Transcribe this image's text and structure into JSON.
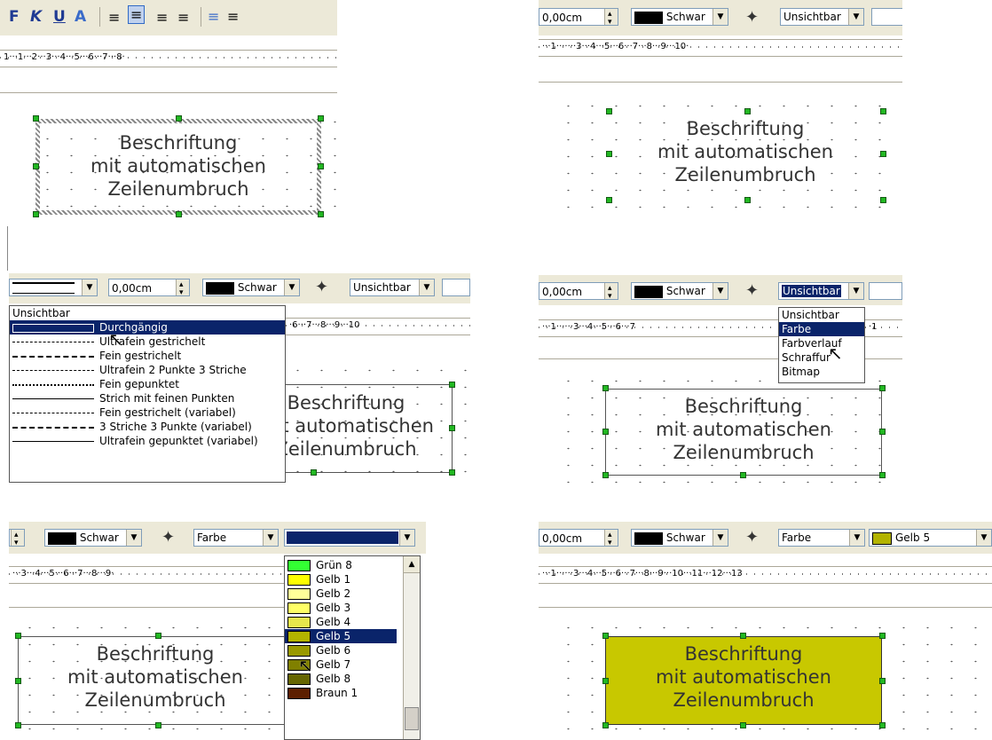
{
  "frame_text": [
    "Beschriftung",
    "mit automatischen",
    "Zeilenumbruch"
  ],
  "format_toolbar": {
    "bold": "F",
    "italic": "K",
    "underline": "U",
    "font_color": "A"
  },
  "ruler1": "1···1···2···3···4···5···6···7···8·",
  "ruler2": "···1·······3···4···5···6···7···8···9···10·",
  "ruler3": "·6···7···8···9···10",
  "ruler4": "···1······3···4···5···6···7",
  "ruler4b": "·1",
  "ruler5": "···3···4···5···6···7···8···9·",
  "ruler6": "···1······3···4···5···6···7···8···9···10···11···12···13",
  "line_width": "0,00cm",
  "line_color": "Schwar",
  "area_style_invisible": "Unsichtbar",
  "area_style_color": "Farbe",
  "fill_color_selected": "Gelb 5",
  "line_style_menu": [
    "Unsichtbar",
    "Durchgängig",
    "Ultrafein gestrichelt",
    "Fein gestrichelt",
    "Ultrafein 2 Punkte 3 Striche",
    "Fein gepunktet",
    "Strich mit feinen Punkten",
    "Fein gestrichelt (variabel)",
    "3 Striche 3 Punkte (variabel)",
    "Ultrafein gepunktet (variabel)"
  ],
  "area_style_menu": [
    "Unsichtbar",
    "Farbe",
    "Farbverlauf",
    "Schraffur",
    "Bitmap"
  ],
  "color_menu": [
    {
      "name": "Grün 8",
      "color": "#33ff33"
    },
    {
      "name": "Gelb 1",
      "color": "#ffff00"
    },
    {
      "name": "Gelb 2",
      "color": "#ffff99"
    },
    {
      "name": "Gelb 3",
      "color": "#ffff66"
    },
    {
      "name": "Gelb 4",
      "color": "#e6e64c"
    },
    {
      "name": "Gelb 5",
      "color": "#b3b300"
    },
    {
      "name": "Gelb 6",
      "color": "#999900"
    },
    {
      "name": "Gelb 7",
      "color": "#808000"
    },
    {
      "name": "Gelb 8",
      "color": "#666600"
    },
    {
      "name": "Braun 1",
      "color": "#5c1f00"
    }
  ],
  "colors": {
    "selection": "#0a246a",
    "handle": "#22b822",
    "fill_yellow": "#c8c800",
    "toolbar": "#ece9d8"
  }
}
